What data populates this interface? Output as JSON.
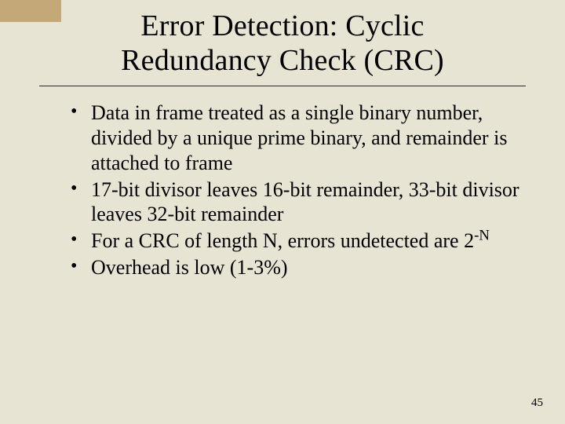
{
  "title_line1": "Error Detection: Cyclic",
  "title_line2": "Redundancy Check (CRC)",
  "bullets": [
    "Data in frame treated as a single binary number, divided by a unique prime binary, and remainder is attached to frame",
    "17-bit divisor leaves 16-bit remainder, 33-bit divisor leaves 32-bit remainder",
    "For a CRC of length N, errors undetected are 2",
    "Overhead is low (1-3%)"
  ],
  "bullet3_sup": "-N",
  "page_number": "45"
}
